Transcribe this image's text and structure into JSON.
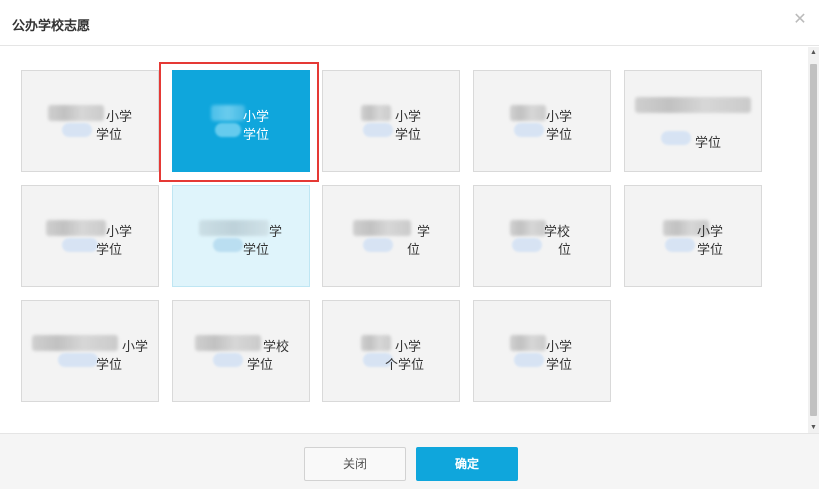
{
  "dialog": {
    "title": "公办学校志愿",
    "close_icon": "close-icon"
  },
  "cards": [
    {
      "line1": "小学",
      "line2": "学位",
      "state": "normal"
    },
    {
      "line1": "小学",
      "line2": "学位",
      "state": "selected"
    },
    {
      "line1": "小学",
      "line2": "学位",
      "state": "normal"
    },
    {
      "line1": "小学",
      "line2": "学位",
      "state": "normal"
    },
    {
      "line1": "",
      "line2": "学位",
      "state": "normal"
    },
    {
      "line1": "小学",
      "line2": "学位",
      "state": "normal"
    },
    {
      "line1": "学",
      "line2": "学位",
      "state": "hover"
    },
    {
      "line1": "学",
      "line2": "位",
      "state": "normal"
    },
    {
      "line1": "学校",
      "line2": "位",
      "state": "normal"
    },
    {
      "line1": "小学",
      "line2": "学位",
      "state": "normal"
    },
    {
      "line1": "小学",
      "line2": "学位",
      "state": "normal"
    },
    {
      "line1": "学校",
      "line2": "学位",
      "state": "normal"
    },
    {
      "line1": "小学",
      "line2": "个学位",
      "state": "normal"
    },
    {
      "line1": "小学",
      "line2": "学位",
      "state": "normal"
    }
  ],
  "footer": {
    "close_label": "关闭",
    "confirm_label": "确定"
  },
  "colors": {
    "accent": "#0fa6dc",
    "highlight_frame": "#e53935",
    "hover_fill": "#dff4fb"
  }
}
